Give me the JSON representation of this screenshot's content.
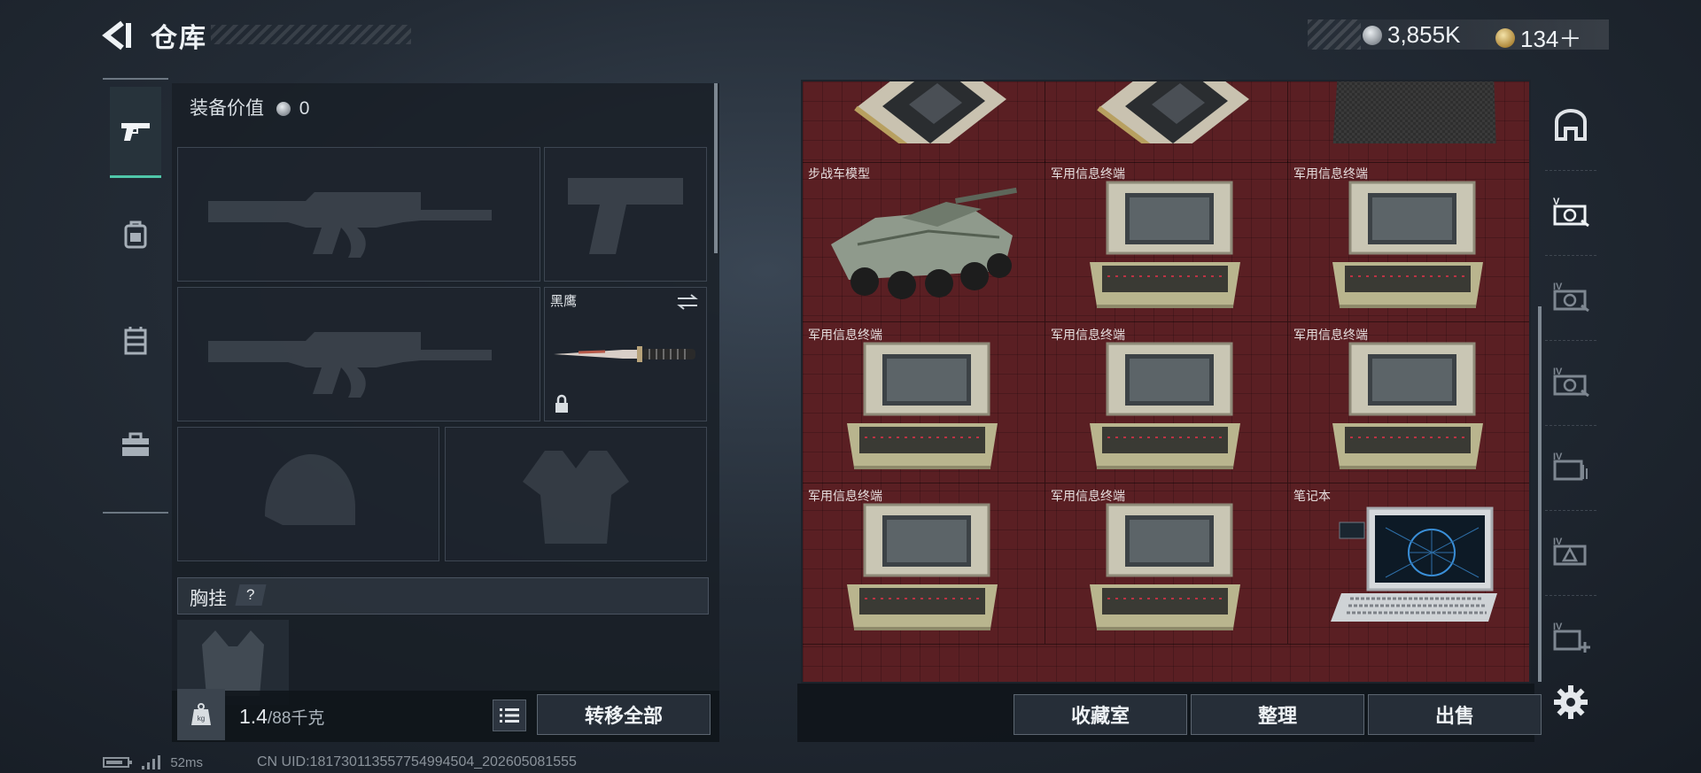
{
  "header": {
    "title": "仓库",
    "currency": [
      {
        "icon": "silver-coin-icon",
        "value": "3,855K"
      },
      {
        "icon": "gold-coin-icon",
        "value": "134＋"
      }
    ]
  },
  "left_tabs": [
    {
      "icon": "pistol-icon",
      "active": true
    },
    {
      "icon": "backpack-icon",
      "active": false
    },
    {
      "icon": "chest-rig-icon",
      "active": false
    },
    {
      "icon": "toolbox-icon",
      "active": false
    }
  ],
  "equipment": {
    "value_label": "装备价值",
    "value": "0",
    "slots": [
      {
        "name": "primary-weapon-slot",
        "label": "",
        "icon": "assault-rifle-icon"
      },
      {
        "name": "pistol-slot",
        "label": "",
        "icon": "pistol-icon"
      },
      {
        "name": "secondary-weapon-slot",
        "label": "",
        "icon": "assault-rifle-icon"
      },
      {
        "name": "melee-slot",
        "label": "黑鹰",
        "icon": "knife-icon"
      },
      {
        "name": "helmet-slot",
        "label": "",
        "icon": "helmet-icon"
      },
      {
        "name": "armor-slot",
        "label": "",
        "icon": "armor-vest-icon"
      }
    ],
    "chest_rig_label": "胸挂",
    "help_label": "?",
    "weight_value": "1.4",
    "weight_max": "/88千克",
    "transfer_all": "转移全部"
  },
  "storage": {
    "items": [
      {
        "label": "",
        "icon": "circuit-board-icon"
      },
      {
        "label": "",
        "icon": "circuit-board-icon"
      },
      {
        "label": "",
        "icon": "carbon-fiber-sheet-icon"
      },
      {
        "label": "步战车模型",
        "icon": "ifv-model-icon"
      },
      {
        "label": "军用信息终端",
        "icon": "military-terminal-icon"
      },
      {
        "label": "军用信息终端",
        "icon": "military-terminal-icon"
      },
      {
        "label": "军用信息终端",
        "icon": "military-terminal-icon"
      },
      {
        "label": "军用信息终端",
        "icon": "military-terminal-icon"
      },
      {
        "label": "军用信息终端",
        "icon": "military-terminal-icon"
      },
      {
        "label": "军用信息终端",
        "icon": "military-terminal-icon"
      },
      {
        "label": "军用信息终端",
        "icon": "military-terminal-icon"
      },
      {
        "label": "笔记本",
        "icon": "laptop-icon"
      }
    ],
    "buttons": {
      "collection": "收藏室",
      "sort": "整理",
      "sell": "出售"
    }
  },
  "right_tabs": [
    {
      "icon": "home-storage-icon",
      "label": ""
    },
    {
      "icon": "storage-tab-5-icon",
      "label": "V"
    },
    {
      "icon": "storage-tab-4a-icon",
      "label": "IV"
    },
    {
      "icon": "storage-tab-4b-icon",
      "label": "IV"
    },
    {
      "icon": "storage-tab-4c-icon",
      "label": "IV"
    },
    {
      "icon": "storage-tab-4d-icon",
      "label": "IV"
    },
    {
      "icon": "storage-tab-4-add-icon",
      "label": "IV"
    }
  ],
  "status": {
    "ping": "52ms",
    "uid": "CN UID:18173011355775499450​4_202605081555"
  }
}
